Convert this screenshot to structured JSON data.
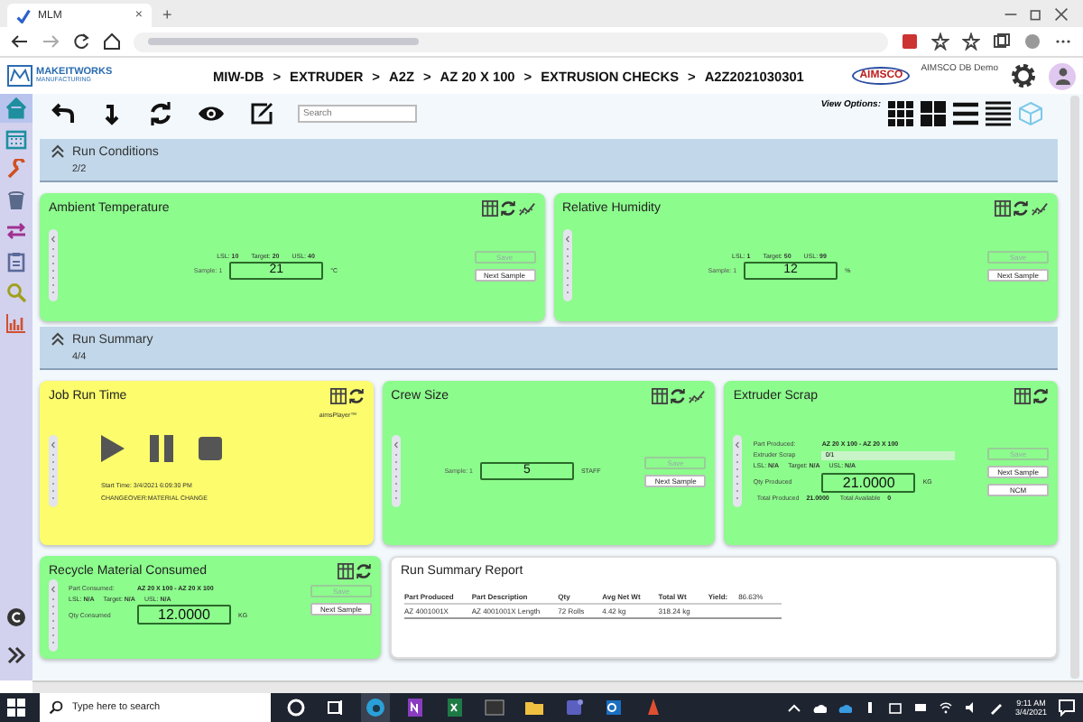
{
  "browser": {
    "tab_title": "MLM",
    "close": "×",
    "new_tab": "+"
  },
  "header": {
    "logo": "MAKEITWORKS",
    "logo_sub": "MANUFACTURING",
    "breadcrumb": [
      "MIW-DB",
      "EXTRUDER",
      "A2Z",
      "AZ 20 X 100",
      "EXTRUSION CHECKS",
      "A2Z2021030301"
    ],
    "separator": ">",
    "brand": "AIMSCO",
    "user": "AIMSCO DB Demo"
  },
  "sidebar": {
    "items": [
      {
        "selected": true
      },
      {
        "selected": false
      },
      {
        "selected": false
      },
      {
        "selected": false
      },
      {
        "selected": false
      },
      {
        "selected": false
      },
      {
        "selected": false
      },
      {
        "selected": false
      }
    ]
  },
  "toolbar": {
    "search_placeholder": "Search",
    "view_options_label": "View Options:",
    "views": [
      {
        "selected": false
      },
      {
        "selected": false
      },
      {
        "selected": false
      },
      {
        "selected": false
      },
      {
        "selected": true
      }
    ]
  },
  "sections": [
    {
      "title": "Run Conditions",
      "count": "2/2",
      "expanded": true,
      "rows": [
        [
          {
            "kind": "sample",
            "title": "Ambient Temperature",
            "color": "#8cfc8c",
            "trend_chart": true,
            "limits": [
              {
                "label": "LSL:",
                "value": "10"
              },
              {
                "label": "Target:",
                "value": "20"
              },
              {
                "label": "USL:",
                "value": "40"
              }
            ],
            "sample_label": "Sample: 1",
            "value": "21",
            "unit": "°C",
            "buttons": [
              {
                "label": "Save",
                "disabled": true
              },
              {
                "label": "Next Sample",
                "disabled": false
              }
            ]
          },
          {
            "kind": "sample",
            "title": "Relative Humidity",
            "color": "#8cfc8c",
            "trend_chart": true,
            "limits": [
              {
                "label": "LSL:",
                "value": "1"
              },
              {
                "label": "Target:",
                "value": "50"
              },
              {
                "label": "USL:",
                "value": "99"
              }
            ],
            "sample_label": "Sample: 1",
            "value": "12",
            "unit": "%",
            "buttons": [
              {
                "label": "Save",
                "disabled": true
              },
              {
                "label": "Next Sample",
                "disabled": false
              }
            ]
          }
        ]
      ]
    },
    {
      "title": "Run Summary",
      "count": "4/4",
      "expanded": true,
      "rows": [
        [
          {
            "kind": "player",
            "title": "Job Run Time",
            "color": "#fcfc6c",
            "trend_chart": false,
            "player_name": "aimsPlayer™",
            "start_time": "Start Time: 3/4/2021 6:09:30 PM",
            "note": "CHANGEOVER:MATERIAL CHANGE"
          },
          {
            "kind": "sample",
            "title": "Crew Size",
            "color": "#8cfc8c",
            "trend_chart": true,
            "sample_label": "Sample: 1",
            "value": "5",
            "unit": "STAFF",
            "buttons": [
              {
                "label": "Save",
                "disabled": true
              },
              {
                "label": "Next Sample",
                "disabled": false
              }
            ]
          },
          {
            "kind": "part",
            "title": "Extruder Scrap",
            "color": "#8cfc8c",
            "trend_chart": false,
            "part_label": "Part Produced:",
            "part": "AZ 20 X 100 - AZ 20 X 100",
            "entry_label": "Extruder Scrap",
            "entry_value": "0/1",
            "limits": [
              {
                "label": "LSL:",
                "value": "N/A"
              },
              {
                "label": "Target:",
                "value": "N/A"
              },
              {
                "label": "USL:",
                "value": "N/A"
              }
            ],
            "qty_label": "Qty Produced",
            "value": "21.0000",
            "unit": "KG",
            "totals": [
              {
                "label": "Total Produced",
                "value": "21.0000"
              },
              {
                "label": "Total Available",
                "value": "0"
              }
            ],
            "buttons": [
              {
                "label": "Save",
                "disabled": true
              },
              {
                "label": "Next Sample",
                "disabled": false
              },
              {
                "label": "NCM",
                "disabled": false
              }
            ]
          }
        ],
        [
          {
            "kind": "part",
            "title": "Recycle Material Consumed",
            "color": "#8cfc8c",
            "trend_chart": false,
            "part_label": "Part Consumed:",
            "part": "AZ 20 X 100 - AZ 20 X 100",
            "limits": [
              {
                "label": "LSL:",
                "value": "N/A"
              },
              {
                "label": "Target:",
                "value": "N/A"
              },
              {
                "label": "USL:",
                "value": "N/A"
              }
            ],
            "qty_label": "Qty Consumed",
            "value": "12.0000",
            "unit": "KG",
            "buttons": [
              {
                "label": "Save",
                "disabled": true
              },
              {
                "label": "Next Sample",
                "disabled": false
              }
            ]
          },
          {
            "kind": "report",
            "title": "Run Summary Report",
            "color": "#ffffff",
            "columns": [
              "Part Produced",
              "Part Description",
              "Qty",
              "Avg Net Wt",
              "Total Wt"
            ],
            "yield_label": "Yield:",
            "yield_value": "86.63%",
            "rows": [
              [
                "AZ 4001001X",
                "AZ 4001001X Length",
                "72 Rolls",
                "4.42 kg",
                "318.24 kg"
              ]
            ]
          }
        ]
      ]
    }
  ],
  "taskbar": {
    "search_placeholder": "Type here to search",
    "time": "9:11 AM",
    "date": "3/4/2021"
  }
}
